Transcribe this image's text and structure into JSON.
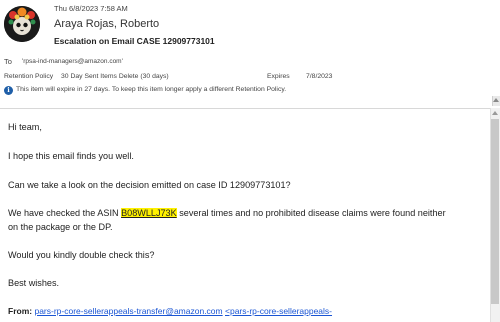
{
  "message": {
    "date": "Thu 6/8/2023 7:58 AM",
    "sender": "Araya Rojas, Roberto",
    "subject": "Escalation on Email CASE 12909773101",
    "to_label": "To",
    "to_value": "'rpsa-ind-managers@amazon.com'",
    "retention_label": "Retention Policy",
    "retention_policy": "30 Day Sent Items Delete (30 days)",
    "expires_label": "Expires",
    "expires_value": "7/8/2023",
    "info_text": "This item will expire in 27 days. To keep this item longer apply a different Retention Policy."
  },
  "body": {
    "greeting": "Hi team,",
    "line1": "I hope this email finds you well.",
    "line2": "Can we take a look on the decision emitted on case ID 12909773101?",
    "line3_before": "We have checked the ASIN ",
    "asin": "B08WLLJ73K",
    "line3_after": " several times and no prohibited disease claims were found neither",
    "line3_cont": "on the package or the DP.",
    "line4": "Would you kindly double check this?",
    "closing": "Best wishes.",
    "from_label": "From:",
    "from_email": "pars-rp-core-sellerappeals-transfer@amazon.com",
    "from_email_bracket": "<pars-rp-core-sellerappeals-"
  },
  "icons": {
    "info": "info-icon",
    "avatar": "sender-avatar"
  },
  "colors": {
    "highlight": "#fff200",
    "link": "#1a55d4",
    "info_icon": "#1f5fa8"
  }
}
